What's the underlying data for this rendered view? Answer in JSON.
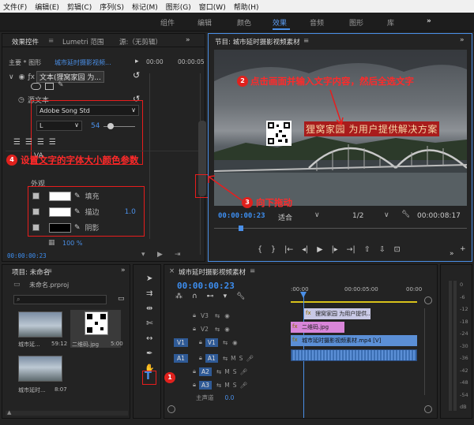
{
  "menu": [
    "文件(F)",
    "编辑(E)",
    "剪辑(C)",
    "序列(S)",
    "标记(M)",
    "图形(G)",
    "窗口(W)",
    "帮助(H)"
  ],
  "workspace_tabs": {
    "t1": "组件",
    "t2": "编辑",
    "t3": "颜色",
    "t4": "效果",
    "t5": "音频",
    "t6": "图形",
    "t7": "库",
    "more": "»"
  },
  "effect_controls": {
    "tab_active": "效果控件",
    "tab2": "Lumetri 范围",
    "tab3": "源:（无剪辑）",
    "more": "»",
    "master": "主要 * 图形",
    "sequence": "城市延时摄影视频...",
    "tc_left": "00:00",
    "tc_right": "00:00:05",
    "text_layer": "文本(狸窝家园 为...",
    "source_text": "源文本",
    "font": "Adobe Song Std",
    "style": "L",
    "size": "54",
    "appearance": "外观",
    "fill": "填充",
    "stroke": "描边",
    "stroke_val": "1.0",
    "shadow": "阴影",
    "zoom": "100 %",
    "timecode": "00:00:00:23"
  },
  "program": {
    "title": "节目: 城市延时摄影视频素材",
    "overlay_text": "狸窝家园 为用户提供解决方案",
    "timecode": "00:00:00:23",
    "fit": "适合",
    "quality": "1/2",
    "duration": "00:00:08:17"
  },
  "project": {
    "title": "项目: 未命名",
    "file": "未命名.prproj",
    "items": [
      {
        "name": "城市延...",
        "dur": "59:12"
      },
      {
        "name": "二维码.jpg",
        "dur": "5:00"
      },
      {
        "name": "城市延时...",
        "dur": "8:07"
      }
    ]
  },
  "timeline": {
    "title": "城市延时摄影视频素材",
    "timecode": "00:00:00:23",
    "ruler": [
      ":00:00",
      "00:00:05:00",
      "00:00"
    ],
    "tracks": [
      "V3",
      "V2",
      "V1",
      "A1",
      "A2",
      "A3",
      "主声道"
    ],
    "src_v": "V1",
    "src_a": "A1",
    "master_val": "0.0",
    "clip_text": "狸窝家园 为用户提供...",
    "clip_qr": "二维码.jpg",
    "clip_video": "城市延时摄影视频素材.mp4 [V]"
  },
  "meter": {
    "labels": [
      "0",
      "-6",
      "-12",
      "-18",
      "-24",
      "-30",
      "-36",
      "-42",
      "-48",
      "-54"
    ],
    "unit": "dB"
  },
  "annotations": {
    "a1": "1",
    "a2": "点击画面并输入文字内容，然后全选文字",
    "n2": "2",
    "a3": "向下拖动",
    "n3": "3",
    "a4": "设置文字的字体大小颜色参数",
    "n4": "4"
  },
  "colors": {
    "accent": "#3d8ef0",
    "annotation": "#e81d1d",
    "text_clip": "#c9c9e6",
    "qr_clip": "#d985d9",
    "video_clip": "#5b8fd6"
  }
}
